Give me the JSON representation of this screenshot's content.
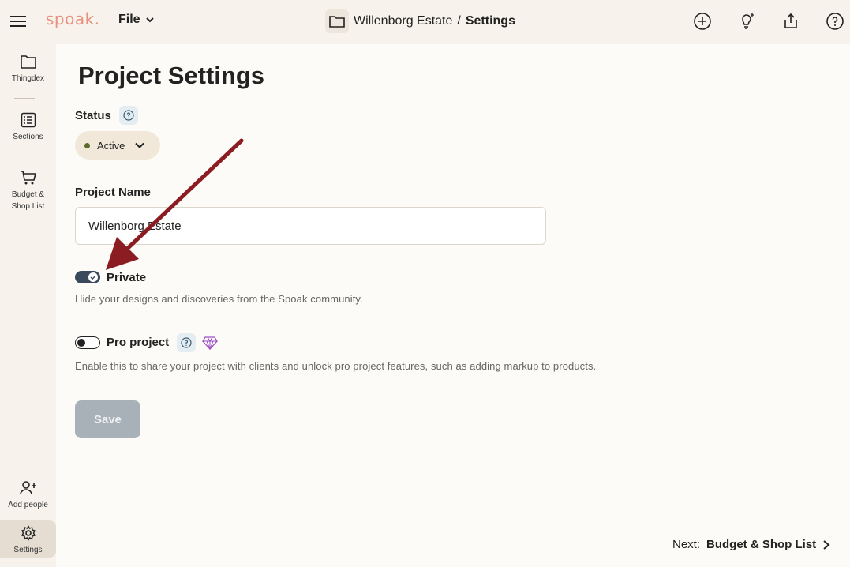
{
  "app": {
    "logo": "spoak."
  },
  "header": {
    "file_menu": "File",
    "breadcrumb_project": "Willenborg Estate",
    "breadcrumb_separator": "/",
    "breadcrumb_current": "Settings",
    "icons": [
      "plus-circle-icon",
      "lightbulb-sparkle-icon",
      "share-icon",
      "help-circle-icon"
    ]
  },
  "sidebar": {
    "items": [
      {
        "label": "Thingdex",
        "icon": "folder-icon"
      },
      {
        "label": "Sections",
        "icon": "list-icon"
      },
      {
        "label": "Budget &",
        "label2": "Shop List",
        "icon": "cart-icon"
      },
      {
        "label": "Add people",
        "icon": "add-person-icon"
      },
      {
        "label": "Settings",
        "icon": "gear-icon",
        "active": true
      }
    ]
  },
  "main": {
    "title": "Project Settings",
    "status_label": "Status",
    "status_value": "Active",
    "project_name_label": "Project Name",
    "project_name_value": "Willenborg Estate",
    "private_label": "Private",
    "private_on": true,
    "private_desc": "Hide your designs and discoveries from the Spoak community.",
    "pro_label": "Pro project",
    "pro_on": false,
    "pro_desc": "Enable this to share your project with clients and unlock pro project features, such as adding markup to products.",
    "save_label": "Save",
    "next_prefix": "Next:",
    "next_target": "Budget & Shop List"
  },
  "colors": {
    "accent_logo": "#e8917f",
    "toggle_on": "#3a4a5c",
    "save_disabled": "#a9b1b8",
    "status_dot": "#5a6b2a",
    "annotation_arrow": "#8a1c22"
  }
}
